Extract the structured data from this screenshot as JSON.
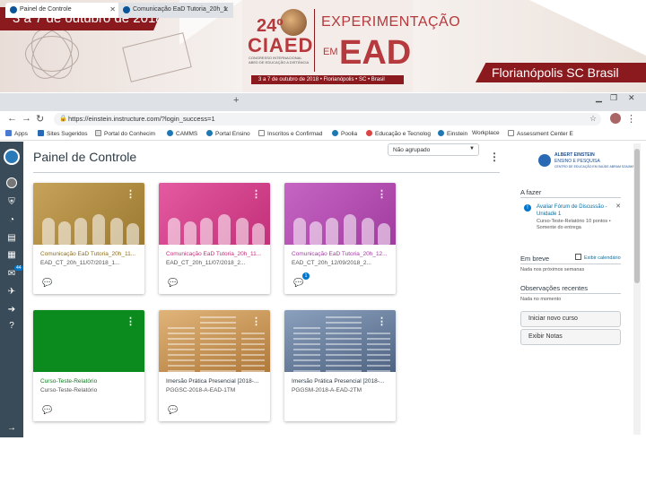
{
  "banner": {
    "date": "3 a 7 de outubro de 2018",
    "ciaed_number": "24º",
    "ciaed_name": "CIAED",
    "ciaed_subtitle": "CONGRESSO INTERNACIONAL ABED DE EDUCAÇÃO A DISTÂNCIA",
    "theme_line1": "EXPERIMENTAÇÃO",
    "theme_em": "EM",
    "theme_ead": "EAD",
    "strip": "3 a 7 de outubro de 2018 • Florianópolis • SC • Brasil",
    "city": "Florianópolis  SC  Brasil"
  },
  "browser": {
    "tabs": [
      {
        "label": "Painel de Controle",
        "active": true
      },
      {
        "label": "Comunicação EaD Tutoria_20h_1",
        "active": false
      }
    ],
    "new_tab": "+",
    "url": "https://einstein.instructure.com/?login_success=1",
    "bookmarks": [
      "Apps",
      "Sites Sugeridos",
      "Portal do Conhecim",
      "CAMMS",
      "Portal Ensino",
      "Inscritos e Confirmad",
      "Poolia",
      "Educação e Tecnolog",
      "Einstein",
      "Workplace",
      "Assessment Center E"
    ]
  },
  "global_nav": {
    "icons": [
      "canvas-logo-icon",
      "account-icon",
      "admin-icon",
      "dashboard-icon",
      "courses-icon",
      "calendar-icon",
      "inbox-icon",
      "commons-icon",
      "logout-icon",
      "help-icon",
      "collapse-icon"
    ],
    "inbox_badge": "44"
  },
  "dashboard": {
    "title": "Painel de Controle",
    "view_select": "Não agrupado",
    "cards": [
      {
        "title": "Comunicação EaD Tutoria_20h_11...",
        "code": "EAD_CT_20h_11/07/2018_1...",
        "color": "#b5923a",
        "title_color": "#8d6e1b",
        "discussion_badge": ""
      },
      {
        "title": "Comunicação EaD Tutoria_20h_11...",
        "code": "EAD_CT_20h_11/07/2018_2...",
        "color": "#d6408a",
        "title_color": "#c2307a",
        "discussion_badge": ""
      },
      {
        "title": "Comunicação EaD Tutoria_20h_12...",
        "code": "EAD_CT_20h_12/09/2018_2...",
        "color": "#b64fb5",
        "title_color": "#a23ca0",
        "discussion_badge": "1"
      },
      {
        "title": "Curso-Teste-Relatório",
        "code": "Curso-Teste-Relatório",
        "color": "#0b8a1e",
        "title_color": "#0b7a1a",
        "discussion_badge": ""
      },
      {
        "title": "Imersão Prática Presencial [2018-...",
        "code": "PGGSC-2018-A-EAD-1TM",
        "color": "#c48a48",
        "title_color": "#2d3b45",
        "discussion_badge": ""
      },
      {
        "title": "Imersão Prática Presencial [2018-...",
        "code": "PGGSM-2018-A-EAD-2TM",
        "color": "#6a7f9c",
        "title_color": "#2d3b45",
        "discussion_badge": ""
      }
    ]
  },
  "sidebar": {
    "logo_line1": "ALBERT EINSTEIN",
    "logo_line2": "ENSINO E PESQUISA",
    "logo_line3": "CENTRO DE EDUCAÇÃO EM SAÚDE ABRAM SZAJMAN",
    "todo_heading": "A fazer",
    "todo_item_title": "Avaliar Fórum de Discussão - Unidade 1",
    "todo_item_meta": "Curso-Teste-Relatório 10 pontos • Somente do entrega",
    "upcoming_heading": "Em breve",
    "calendar_link": "Exibir calendário",
    "upcoming_empty": "Nada nos próximos semanas",
    "feedback_heading": "Observações recentes",
    "feedback_empty": "Nada no momento",
    "start_course_button": "Iniciar novo curso",
    "view_grades_button": "Exibir Notas"
  }
}
